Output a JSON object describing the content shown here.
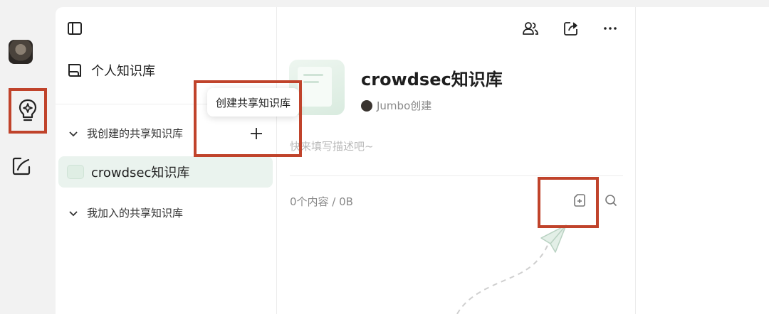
{
  "sidebar": {
    "personal_label": "个人知识库",
    "group_created_label": "我创建的共享知识库",
    "group_joined_label": "我加入的共享知识库",
    "items": [
      {
        "label": "crowdsec知识库",
        "selected": true
      }
    ]
  },
  "tooltip": {
    "text": "创建共享知识库"
  },
  "main": {
    "title": "crowdsec知识库",
    "creator": "Jumbo创建",
    "description_placeholder": "快来填写描述吧~",
    "content_count": "0个内容 / 0B"
  },
  "icons": {
    "rail": [
      "avatar",
      "knowledge-bulb-icon",
      "edit-icon"
    ],
    "toolbar": [
      "members-icon",
      "share-icon",
      "more-icon"
    ]
  },
  "colors": {
    "highlight": "#c0432b",
    "selected_bg": "#eaf3ee",
    "accent_green": "#a8c8b4"
  }
}
